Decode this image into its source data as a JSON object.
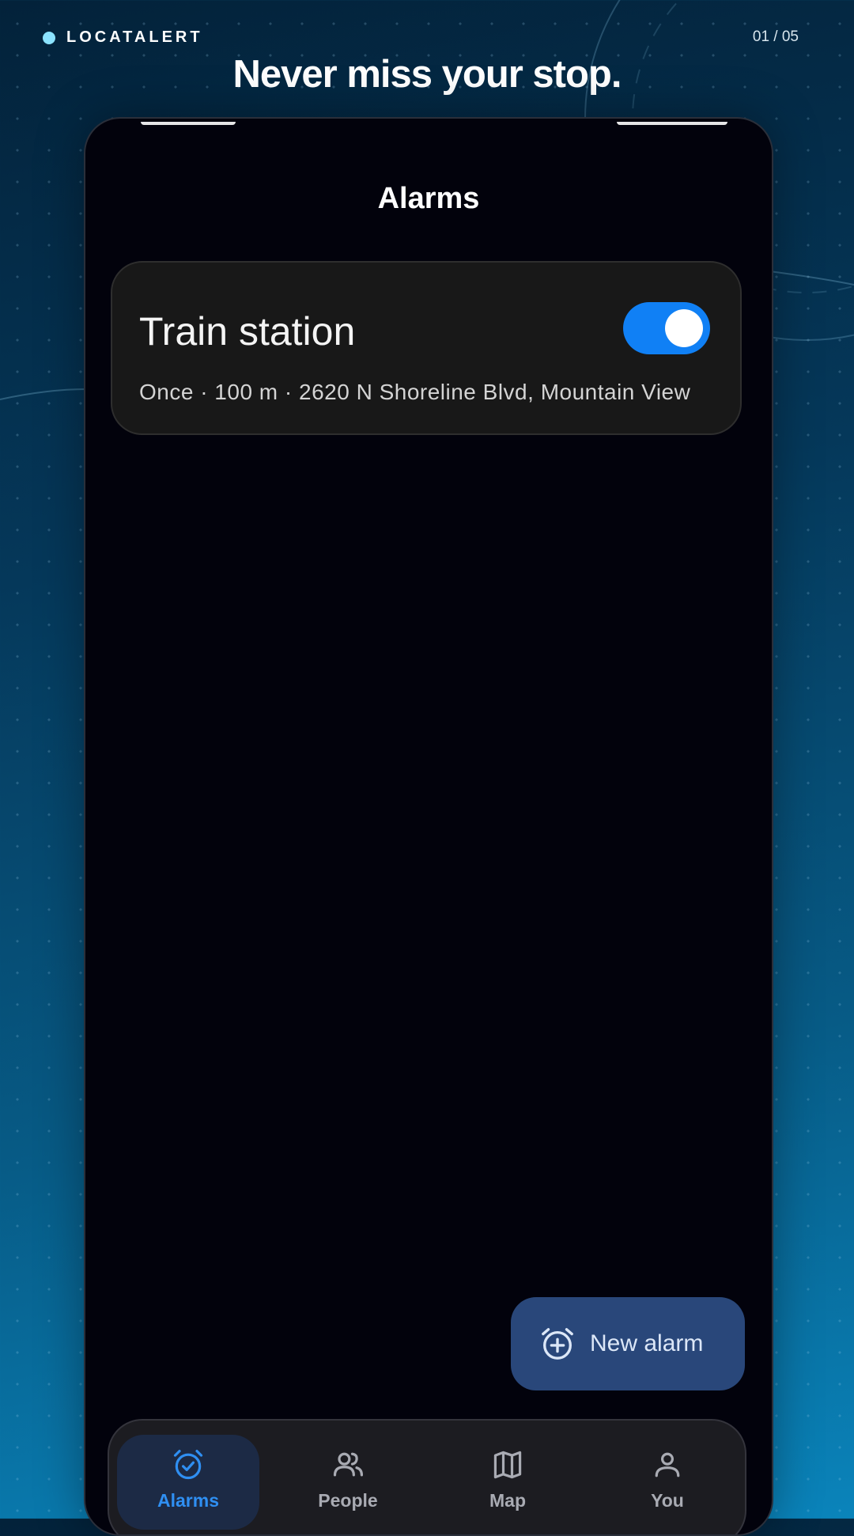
{
  "app": {
    "brand": "LOCATALERT",
    "page_counter": "01 / 05",
    "headline": "Never miss your stop."
  },
  "screen": {
    "title": "Alarms"
  },
  "alarms": [
    {
      "name": "Train station",
      "detail": "Once · 100 m · 2620 N Shoreline Blvd, Mountain View",
      "enabled": true
    }
  ],
  "fab": {
    "label": "New alarm",
    "icon": "alarm-add-icon"
  },
  "nav": {
    "items": [
      {
        "label": "Alarms",
        "icon": "alarm-check-icon",
        "active": true
      },
      {
        "label": "People",
        "icon": "people-icon",
        "active": false
      },
      {
        "label": "Map",
        "icon": "map-icon",
        "active": false
      },
      {
        "label": "You",
        "icon": "person-icon",
        "active": false
      }
    ]
  },
  "colors": {
    "accent": "#1080f5",
    "fab": "#29477a",
    "brand_dot": "#8be3ff",
    "nav_active": "#2f8ff2"
  }
}
